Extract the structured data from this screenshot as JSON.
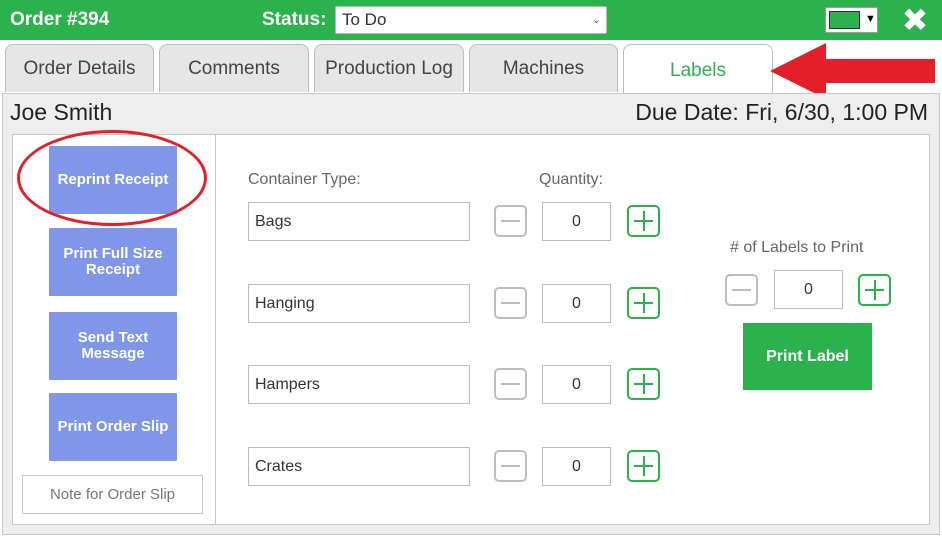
{
  "header": {
    "order_title": "Order #394",
    "status_label": "Status:",
    "status_value": "To Do",
    "color_value": "#2bb24c",
    "close_icon": "close-icon"
  },
  "tabs": [
    {
      "label": "Order Details",
      "active": false
    },
    {
      "label": "Comments",
      "active": false
    },
    {
      "label": "Production Log",
      "active": false
    },
    {
      "label": "Machines",
      "active": false
    },
    {
      "label": "Labels",
      "active": true
    }
  ],
  "customer": {
    "name": "Joe Smith",
    "due_date": "Due Date: Fri, 6/30, 1:00 PM"
  },
  "side_buttons": [
    {
      "label": "Reprint Receipt"
    },
    {
      "label": "Print Full Size Receipt"
    },
    {
      "label": "Send Text Message"
    },
    {
      "label": "Print Order Slip"
    }
  ],
  "note": {
    "placeholder": "Note for Order Slip"
  },
  "labels": {
    "container_type_header": "Container Type:",
    "quantity_header": "Quantity:",
    "containers": [
      {
        "type": "Bags",
        "quantity": "0"
      },
      {
        "type": "Hanging",
        "quantity": "0"
      },
      {
        "type": "Hampers",
        "quantity": "0"
      },
      {
        "type": "Crates",
        "quantity": "0"
      }
    ],
    "labels_to_print_header": "# of Labels to Print",
    "labels_to_print_value": "0",
    "print_label_button": "Print Label"
  },
  "colors": {
    "brand_green": "#2bb24c",
    "button_blue": "#7f96e9",
    "annotation_red": "#e3202a"
  }
}
